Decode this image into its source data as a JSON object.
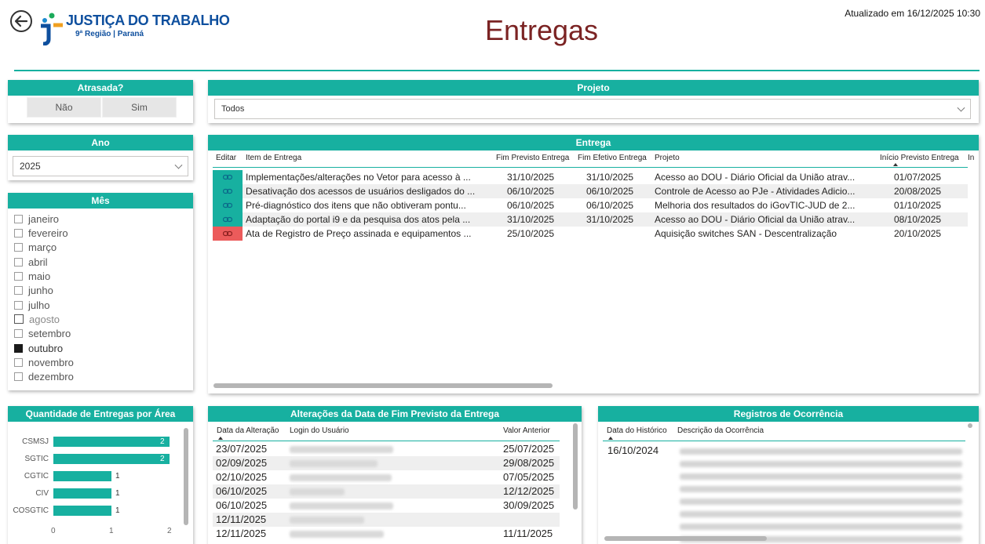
{
  "header": {
    "logo_title": "JUSTIÇA DO TRABALHO",
    "logo_subtitle": "9ª Região | Paraná",
    "page_title": "Entregas",
    "updated": "Atualizado em 16/12/2025 10:30"
  },
  "atrasada": {
    "title": "Atrasada?",
    "options": [
      "Não",
      "Sim"
    ]
  },
  "projeto": {
    "title": "Projeto",
    "value": "Todos"
  },
  "ano": {
    "title": "Ano",
    "value": "2025"
  },
  "mes": {
    "title": "Mês",
    "months": [
      "janeiro",
      "fevereiro",
      "março",
      "abril",
      "maio",
      "junho",
      "julho",
      "agosto",
      "setembro",
      "outubro",
      "novembro",
      "dezembro"
    ],
    "selected": "outubro"
  },
  "entrega": {
    "title": "Entrega",
    "columns": [
      "Editar",
      "Item de Entrega",
      "Fim Previsto Entrega",
      "Fim Efetivo Entrega",
      "Projeto",
      "Início Previsto Entrega",
      "In"
    ],
    "rows": [
      {
        "item": "Implementações/alterações no Vetor para acesso à ...",
        "fim_previsto": "31/10/2025",
        "fim_efetivo": "31/10/2025",
        "projeto": "Acesso ao DOU - Diário Oficial da União atrav...",
        "inicio": "01/07/2025",
        "status_color": "#17b0a0"
      },
      {
        "item": "Desativação dos acessos de usuários desligados do ...",
        "fim_previsto": "06/10/2025",
        "fim_efetivo": "06/10/2025",
        "projeto": "Controle de Acesso ao PJe - Atividades Adicio...",
        "inicio": "20/08/2025",
        "status_color": "#17b0a0"
      },
      {
        "item": "Pré-diagnóstico dos itens que não obtiveram pontu...",
        "fim_previsto": "06/10/2025",
        "fim_efetivo": "06/10/2025",
        "projeto": "Melhoria dos resultados do iGovTIC-JUD de 2...",
        "inicio": "01/10/2025",
        "status_color": "#17b0a0"
      },
      {
        "item": "Adaptação do portal i9 e da pesquisa dos atos pela ...",
        "fim_previsto": "31/10/2025",
        "fim_efetivo": "31/10/2025",
        "projeto": "Acesso ao DOU - Diário Oficial da União atrav...",
        "inicio": "08/10/2025",
        "status_color": "#17b0a0"
      },
      {
        "item": "Ata de Registro de Preço assinada e equipamentos ...",
        "fim_previsto": "25/10/2025",
        "fim_efetivo": "",
        "projeto": "Aquisição switches SAN - Descentralização",
        "inicio": "20/10/2025",
        "status_color": "#ec5b5b"
      }
    ]
  },
  "chart_data": {
    "type": "bar",
    "title": "Quantidade de Entregas por Área",
    "orientation": "horizontal",
    "categories": [
      "CSMSJ",
      "SGTIC",
      "CGTIC",
      "CIV",
      "COSGTIC"
    ],
    "values": [
      2,
      2,
      1,
      1,
      1
    ],
    "xlim": [
      0,
      2
    ],
    "xticks": [
      "0",
      "1",
      "2"
    ],
    "grid": false
  },
  "alteracoes": {
    "title": "Alterações da Data de Fim Previsto da Entrega",
    "columns": [
      "Data da Alteração",
      "Login do Usuário",
      "Valor Anterior"
    ],
    "rows": [
      {
        "data": "23/07/2025",
        "valor": "25/07/2025"
      },
      {
        "data": "02/09/2025",
        "valor": "29/08/2025"
      },
      {
        "data": "02/10/2025",
        "valor": "07/05/2025"
      },
      {
        "data": "06/10/2025",
        "valor": "12/12/2025"
      },
      {
        "data": "06/10/2025",
        "valor": "30/09/2025"
      },
      {
        "data": "12/11/2025",
        "valor": ""
      },
      {
        "data": "12/11/2025",
        "valor": "11/11/2025"
      }
    ]
  },
  "ocorrencia": {
    "title": "Registros de Ocorrência",
    "columns": [
      "Data do Histórico",
      "Descrição da Ocorrência"
    ],
    "rows": [
      {
        "data": "16/10/2024"
      }
    ]
  }
}
